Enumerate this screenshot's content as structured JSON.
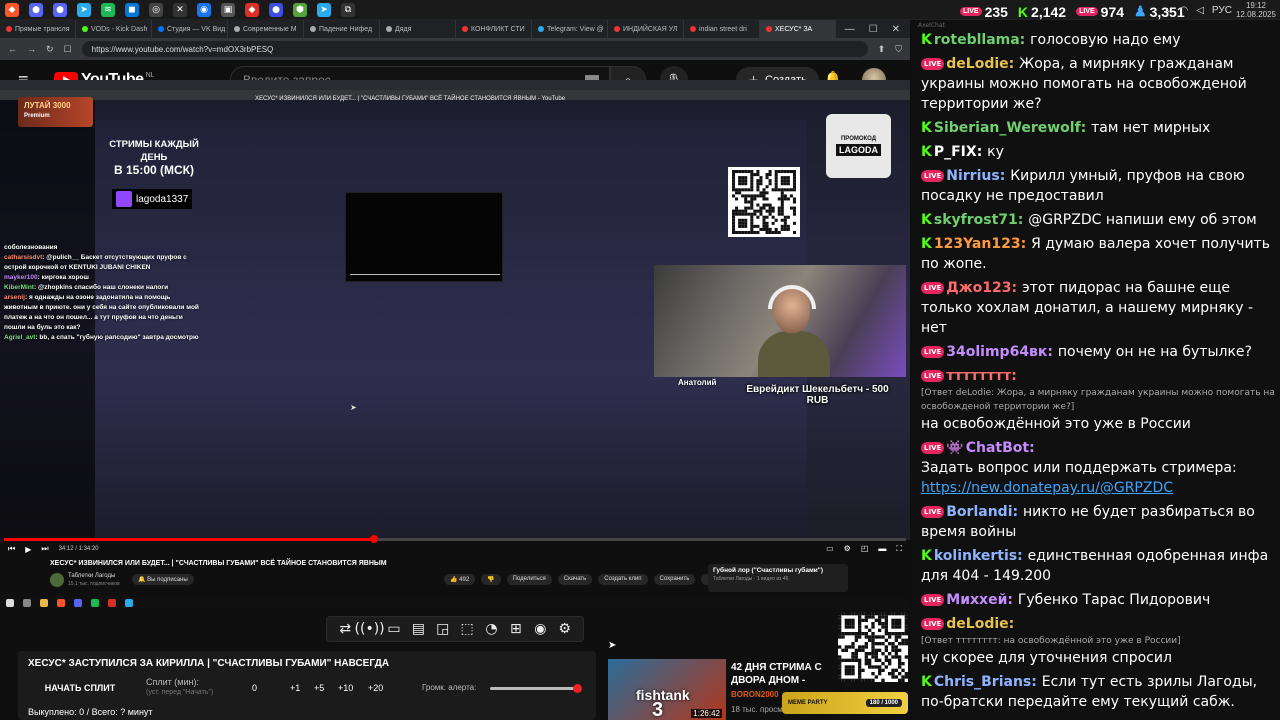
{
  "system": {
    "lang": "РУС",
    "time": "19:12",
    "date": "12.08.2025"
  },
  "chat_stats": {
    "youtube_viewers": "235",
    "kick_viewers": "2,142",
    "twitch_viewers": "974",
    "total_viewers": "3,351"
  },
  "browser": {
    "tabs": [
      {
        "label": "Прямые трансля",
        "color": "#e33"
      },
      {
        "label": "VODs - Kick Dash",
        "color": "#53fc18"
      },
      {
        "label": "Студия — VK Вид",
        "color": "#07f"
      },
      {
        "label": "Современные М",
        "color": "#aaa"
      },
      {
        "label": "Падение Нифед",
        "color": "#aaa"
      },
      {
        "label": "Дядя",
        "color": "#aaa"
      },
      {
        "label": "КОНФЛИКТ СТИ",
        "color": "#e33"
      },
      {
        "label": "Telegram: View @",
        "color": "#2aabee"
      },
      {
        "label": "ИНДИЙСКАЯ УЛ",
        "color": "#e33"
      },
      {
        "label": "indian street dri",
        "color": "#e33"
      },
      {
        "label": "ХЕСУС* ЗА",
        "color": "#e33"
      }
    ],
    "url": "https://www.youtube.com/watch?v=mdOX3rbPESQ"
  },
  "youtube": {
    "logo_text": "YouTube",
    "region": "NL",
    "search_placeholder": "Введите запрос",
    "create_label": "Создать"
  },
  "stream_overlay": {
    "lutai_logo": "ЛУТАЙ 3000",
    "premium": "Premium",
    "schedule_line1": "СТРИМЫ КАЖДЫЙ ДЕНЬ",
    "schedule_line2": "В 15:00 (МСК)",
    "twitch_handle": "lagoda1337",
    "inner_title": "ХЕСУС* ИЗВИНИЛСЯ ИЛИ БУДЕТ... | \"СЧАСТЛИВЫ ГУБАМИ\" ВСЁ ТАЙНОЕ СТАНОВИТСЯ ЯВНЫМ - YouTube",
    "promo_small": "ПРОМОКОД",
    "promo_big": "LAGODA",
    "donation_text": "Еврейдикт Шекельбетч - 500 RUB",
    "donor_small": "Анатолий",
    "inner_chat": [
      {
        "user": "",
        "text": "соболезнования",
        "cls": ""
      },
      {
        "user": "catharsisdvt",
        "text": ": @pulich__ Баскет отсутствующих пруфов с острой корочкой от KENTUKI JUBANI CHIKEN",
        "cls": "u1"
      },
      {
        "user": "mayker100",
        "text": ": киргока хорош",
        "cls": "u3"
      },
      {
        "user": "KiberMint",
        "text": ": @zhopkins спасибо наш слонеки налоги",
        "cls": "u2"
      },
      {
        "user": "arsenij",
        "text": ": я однажды на озоне задонатила на помощь животным в приюте. они у себя на сайте опубликовали мой платеж а на что он пошел... а тут пруфов на что деньги пошли на буль это как?",
        "cls": "u1"
      },
      {
        "user": "Agriel_avt",
        "text": ": bb, а спать \"губную рапсодию\" завтра досмотрю",
        "cls": "u2"
      }
    ]
  },
  "player": {
    "time": "34:12 / 1:34:20",
    "progress": 0.41,
    "video_title": "ХЕСУС* ИЗВИНИЛСЯ ИЛИ БУДЕТ... | \"СЧАСТЛИВЫ ГУБАМИ\" ВСЁ ТАЙНОЕ СТАНОВИТСЯ ЯВНЫМ",
    "channel": "Таблетки Лагоды",
    "subs": "15,1 тыс. подписчиков",
    "subscribed": "Вы подписаны",
    "likes": "492",
    "share": "Поделиться",
    "download": "Скачать",
    "clip": "Создать клип",
    "save": "Сохранить",
    "side_card_title": "Губной лор (\"Счастливы губами\")",
    "side_card_sub": "Таблетки Лагоды · 1 видео из 46"
  },
  "toolbar": {
    "icons": [
      "loop-icon",
      "broadcast-icon",
      "screen-share-icon",
      "clapperboard-icon",
      "crop-icon",
      "region-icon",
      "speed-icon",
      "add-box-icon",
      "camera-icon",
      "settings-icon"
    ],
    "glyphs": [
      "⇄",
      "((•))",
      "▭",
      "▤",
      "◲",
      "⬚",
      "◔",
      "⊞",
      "◉",
      "⚙"
    ]
  },
  "split_panel": {
    "title": "ХЕСУС* ЗАСТУПИЛСЯ ЗА КИРИЛЛА | \"СЧАСТЛИВЫ ГУБАМИ\" НАВСЕГДА",
    "start_label": "НАЧАТЬ СПЛИТ",
    "split_label": "Сплит (мин):",
    "split_hint": "(уст. перед \"Начать\")",
    "split_value": "0",
    "increments": [
      "+1",
      "+5",
      "+10",
      "+20"
    ],
    "alert_label": "Громк. алерта:",
    "alert_volume": 1.0,
    "footer": "Выкуплено: 0 / Всего: ? минут"
  },
  "promo_stream": {
    "title": "42 ДНЯ СТРИМА С ДВОРА ДНОМ - fishtank 3",
    "channel": "BORON2000",
    "views": "18 тыс. просм",
    "duration": "1:26:42",
    "thumb_logo": "fishtank",
    "thumb_num": "3",
    "meme_party": "MEME PARTY",
    "meme_progress": "180 / 1000"
  },
  "chat": {
    "header": "AxelChat",
    "messages": [
      {
        "platform": "kick",
        "user": "rotebllama",
        "color": "#6fd06f",
        "text": "голосовую надо ему"
      },
      {
        "platform": "youtube",
        "user": "deLodie",
        "color": "#e8c24a",
        "text": "Жора, а мирняку гражданам украины можно помогать на освобожденой территории же?"
      },
      {
        "platform": "kick",
        "user": "Siberian_Werewolf",
        "color": "#6fd06f",
        "text": "там нет мирных"
      },
      {
        "platform": "kick",
        "user": "P_FIX",
        "color": "#ffffff",
        "text": "ку"
      },
      {
        "platform": "youtube",
        "user": "Nirrius",
        "color": "#8fb4ff",
        "text": "Кирилл умный, пруфов на свою посадку не предоставил"
      },
      {
        "platform": "kick",
        "user": "skyfrost71",
        "color": "#6fd06f",
        "text": "@GRPZDC напиши ему об этом"
      },
      {
        "platform": "kick",
        "user": "123Yan123",
        "color": "#ff9b3d",
        "text": "Я думаю валера хочет получить по жопе."
      },
      {
        "platform": "youtube",
        "user": "Джо123",
        "color": "#ff6a6a",
        "text": "этот пидорас на башне еще только хохлам донатил, а нашему мирняку - нет"
      },
      {
        "platform": "youtube",
        "user": "34olimp64вк",
        "color": "#c48cff",
        "text": "почему он не на бутылке?"
      },
      {
        "platform": "youtube",
        "user": "тттттттт",
        "color": "#ff6a6a",
        "text": "на освобождённой это уже в России",
        "reply": "[Ответ deLodie: Жора, а мирняку гражданам украины можно помогать на освобожденой территории же?]"
      },
      {
        "platform": "youtube-bot",
        "user": "ChatBot",
        "color": "#c48cff",
        "text": "Задать вопрос или поддержать стримера:",
        "link": "https://new.donatepay.ru/@GRPZDC"
      },
      {
        "platform": "youtube",
        "user": "Borlandi",
        "color": "#8fb4ff",
        "text": "никто не будет разбираться во время войны"
      },
      {
        "platform": "kick",
        "user": "kolinkertis",
        "color": "#8fb4ff",
        "text": "единственная одобренная инфа для 404 - 149.200"
      },
      {
        "platform": "youtube",
        "user": "Миххей",
        "color": "#c48cff",
        "text": "Губенко Тарас Пидорович"
      },
      {
        "platform": "youtube",
        "user": "deLodie",
        "color": "#e8c24a",
        "text": "ну скорее для уточнения спросил",
        "reply": "[Ответ тттттттт: на освобождённой это уже в России]"
      },
      {
        "platform": "kick",
        "user": "Chris_Brians",
        "color": "#8fb4ff",
        "text": "Если тут есть зрилы Лагоды, по-братски передайте ему текущий сабж."
      }
    ]
  }
}
